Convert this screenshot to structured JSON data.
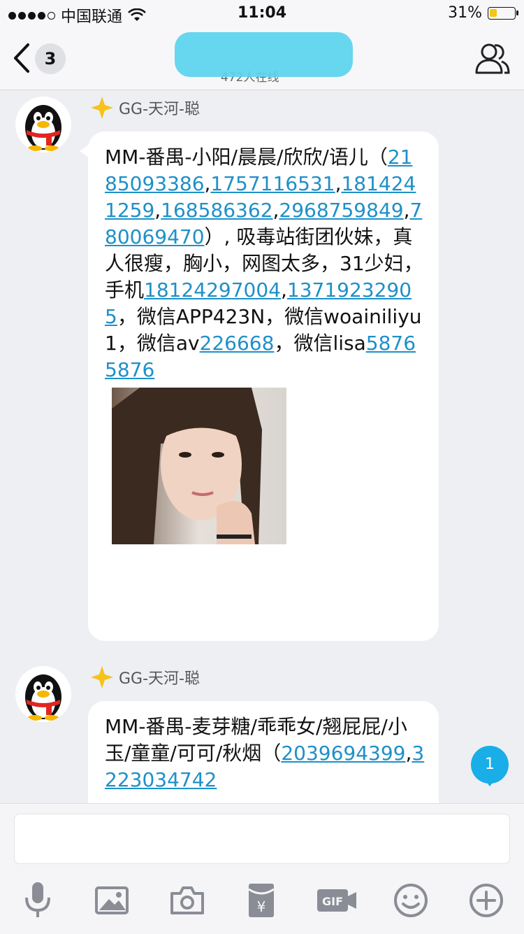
{
  "status_bar": {
    "carrier": "中国联通",
    "time": "11:04",
    "battery_percent_label": "31%",
    "battery_level": 0.31
  },
  "nav": {
    "back_count": "3",
    "online_text": "472人在线"
  },
  "messages": [
    {
      "sender": "GG-天河-聪",
      "segments": [
        {
          "text": "MM-番禺-小阳/晨晨/欣欣/语儿（",
          "link": false
        },
        {
          "text": "2185093386",
          "link": true
        },
        {
          "text": ",",
          "link": false
        },
        {
          "text": "1757116531",
          "link": true
        },
        {
          "text": ",",
          "link": false
        },
        {
          "text": "1814241259",
          "link": true
        },
        {
          "text": ",",
          "link": false
        },
        {
          "text": "168586362",
          "link": true
        },
        {
          "text": ",",
          "link": false
        },
        {
          "text": "2968759849",
          "link": true
        },
        {
          "text": ",",
          "link": false
        },
        {
          "text": "780069470",
          "link": true
        },
        {
          "text": "）, 吸毒站街团伙妹，真人很瘦，胸小，网图太多，31少妇，手机",
          "link": false
        },
        {
          "text": "18124297004",
          "link": true
        },
        {
          "text": ",",
          "link": false
        },
        {
          "text": "13719232905",
          "link": true
        },
        {
          "text": "，微信APP423N，微信woainiliyu1，微信av",
          "link": false
        },
        {
          "text": "226668",
          "link": true
        },
        {
          "text": "，微信lisa",
          "link": false
        },
        {
          "text": "58765876",
          "link": true
        }
      ],
      "has_photo": true
    },
    {
      "sender": "GG-天河-聪",
      "segments": [
        {
          "text": "MM-番禺-麦芽糖/乖乖女/翘屁屁/小玉/童童/可可/秋烟（",
          "link": false
        },
        {
          "text": "2039694399",
          "link": true
        },
        {
          "text": ",",
          "link": false
        },
        {
          "text": "3223034742",
          "link": true
        }
      ],
      "has_photo": false
    }
  ],
  "unread_badge": "1",
  "input": {
    "value": "",
    "placeholder": ""
  },
  "toolbar_icons": [
    "microphone-icon",
    "image-icon",
    "camera-icon",
    "red-packet-icon",
    "gif-icon",
    "emoji-icon",
    "plus-icon"
  ],
  "colors": {
    "link": "#1e90c8",
    "badge": "#19aee8",
    "redaction": "#5ad3ee",
    "battery_fill": "#f5c518"
  }
}
